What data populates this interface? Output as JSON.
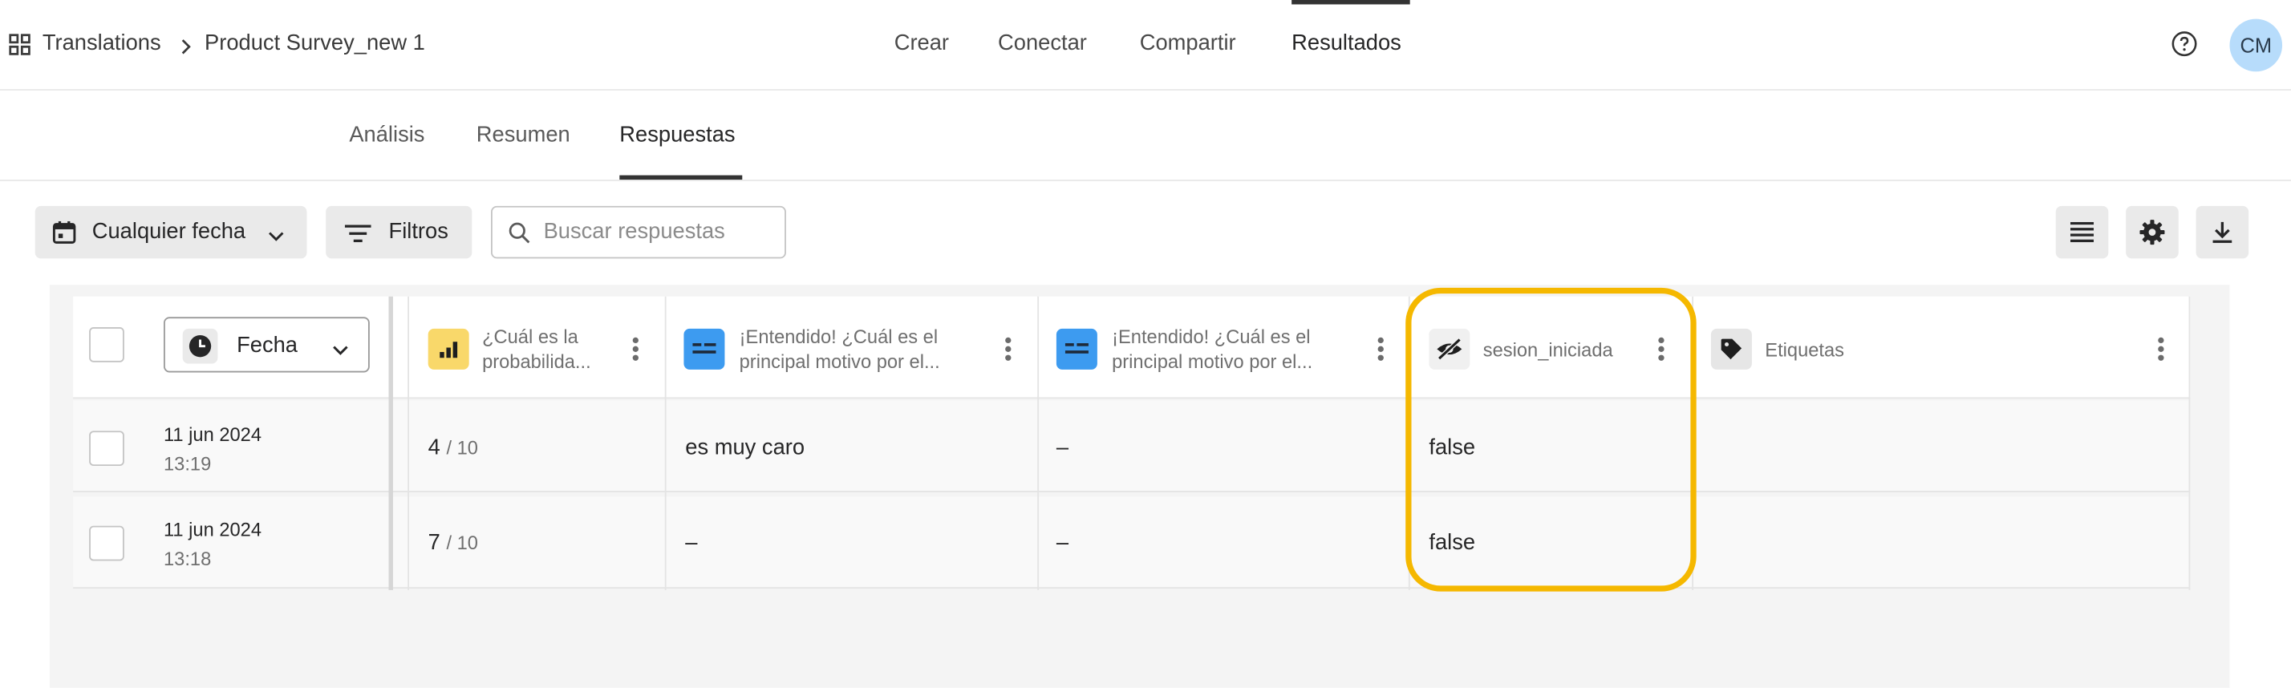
{
  "topbar": {
    "breadcrumb": [
      "Translations",
      "Product Survey_new 1"
    ],
    "tabs": [
      "Crear",
      "Conectar",
      "Compartir",
      "Resultados"
    ],
    "active_tab": "Resultados",
    "avatar_initials": "CM"
  },
  "subtabs": {
    "items": [
      "Análisis",
      "Resumen",
      "Respuestas"
    ],
    "active": "Respuestas"
  },
  "toolbar": {
    "date_filter_label": "Cualquier fecha",
    "filters_label": "Filtros",
    "search_placeholder": "Buscar respuestas"
  },
  "table": {
    "date_column_label": "Fecha",
    "columns": [
      {
        "label": "¿Cuál es la probabilida...",
        "icon": "rating-bars-icon",
        "icon_color": "#f9d86a"
      },
      {
        "label": "¡Entendido! ¿Cuál es el principal motivo por el...",
        "icon": "text-field-icon",
        "icon_color": "#3d9bf0"
      },
      {
        "label": "¡Entendido! ¿Cuál es el principal motivo por el...",
        "icon": "text-field-icon",
        "icon_color": "#3d9bf0"
      },
      {
        "label": "sesion_iniciada",
        "icon": "eye-hidden-icon",
        "icon_color": "#f0f0f0"
      },
      {
        "label": "Etiquetas",
        "icon": "tag-icon",
        "icon_color": "#e6e6e6"
      }
    ],
    "rows": [
      {
        "date": "11 jun 2024",
        "time": "13:19",
        "score": "4",
        "score_max": "/ 10",
        "answer1": "es muy caro",
        "answer2": "–",
        "sesion_iniciada": "false"
      },
      {
        "date": "11 jun 2024",
        "time": "13:18",
        "score": "7",
        "score_max": "/ 10",
        "answer1": "–",
        "answer2": "–",
        "sesion_iniciada": "false"
      }
    ]
  },
  "highlight_color": "#f5b800"
}
